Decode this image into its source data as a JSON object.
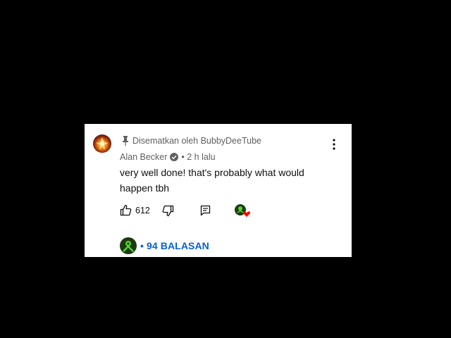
{
  "comment": {
    "pinned_label": "Disematkan oleh BubbyDeeTube",
    "author": "Alan Becker",
    "time": "• 2 h lalu",
    "text": "very well done! that's probably what would happen tbh",
    "like_count": "612",
    "replies_label": "• 94 BALASAN"
  },
  "icons": {
    "pin": "pin-icon",
    "verified": "verified-check-icon",
    "menu": "more-vert-icon",
    "like": "thumbs-up-icon",
    "dislike": "thumbs-down-icon",
    "reply": "reply-icon",
    "creator_heart": "creator-heart-icon"
  },
  "colors": {
    "background": "#000000",
    "card": "#ffffff",
    "text_primary": "#0f0f0f",
    "text_secondary": "#606060",
    "link": "#065fd4",
    "heart": "#ff0000"
  }
}
